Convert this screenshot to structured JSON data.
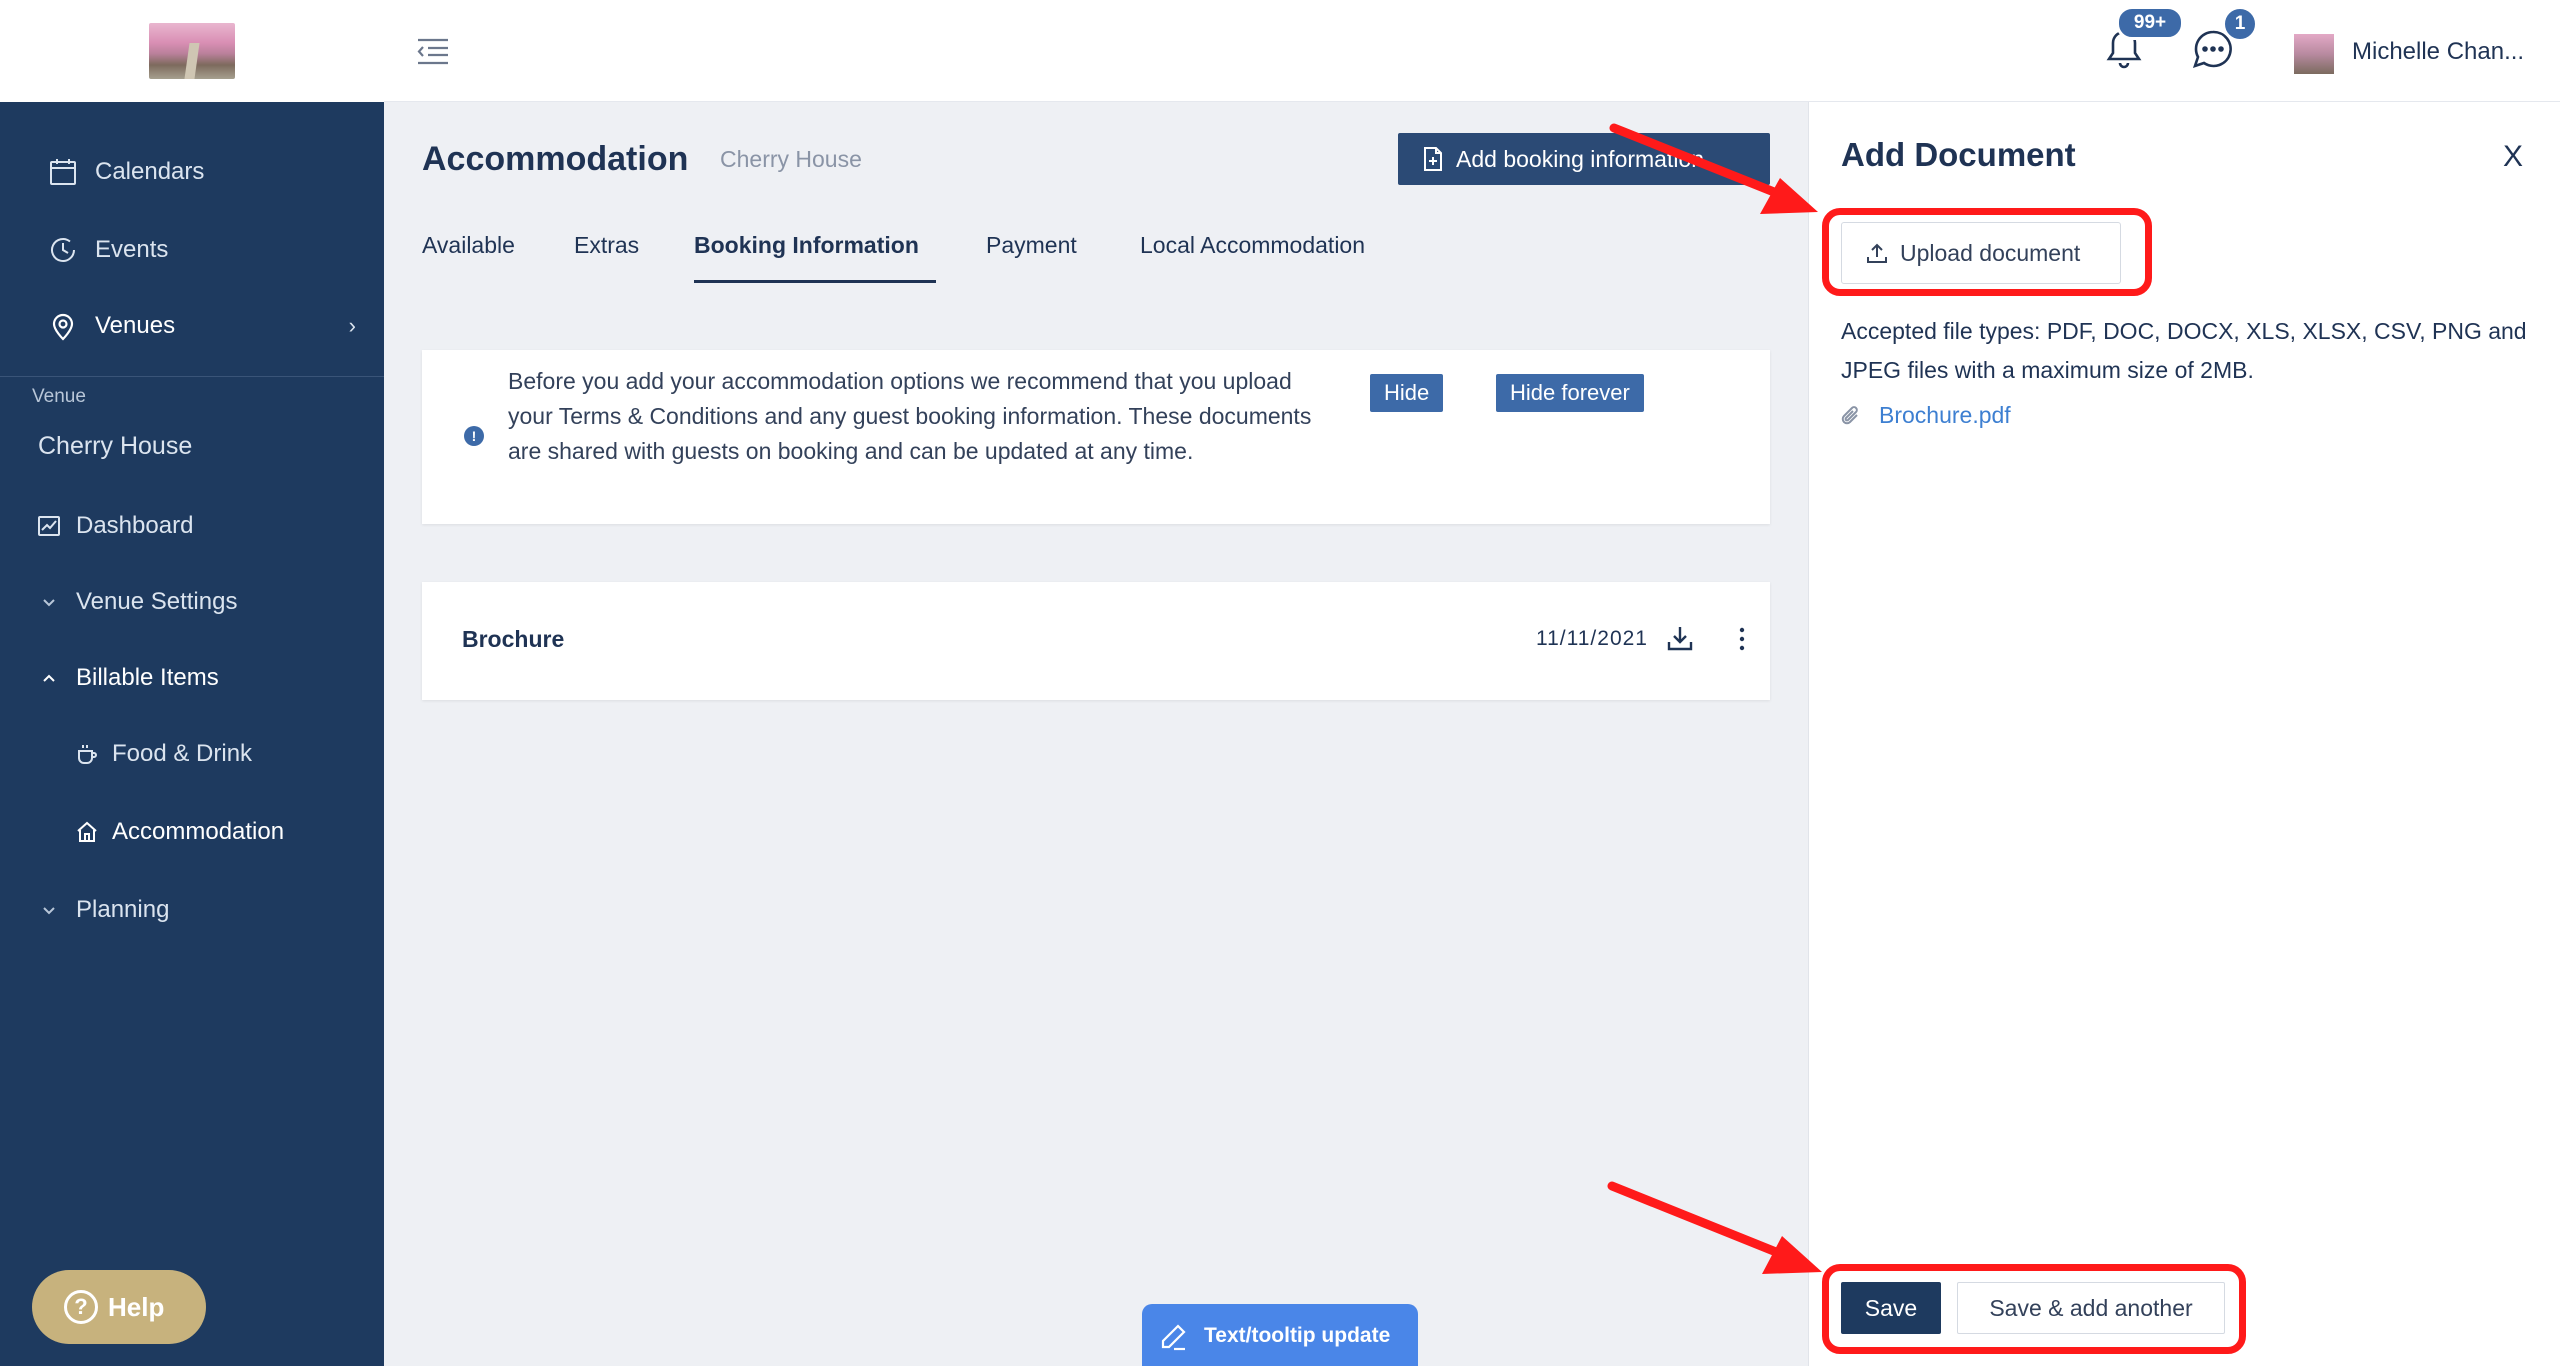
{
  "sidebar": {
    "nav": [
      {
        "label": "Calendars",
        "icon": "calendar-icon"
      },
      {
        "label": "Events",
        "icon": "clock-icon"
      },
      {
        "label": "Venues",
        "icon": "location-pin-icon"
      }
    ],
    "venue_caption": "Venue",
    "venue_name": "Cherry House",
    "items": [
      {
        "label": "Dashboard",
        "icon": "chart-icon"
      },
      {
        "label": "Venue Settings",
        "icon": "chevron-down-icon"
      },
      {
        "label": "Billable Items",
        "icon": "chevron-up-icon"
      },
      {
        "label": "Food & Drink",
        "icon": "coffee-cup-icon"
      },
      {
        "label": "Accommodation",
        "icon": "home-icon"
      },
      {
        "label": "Planning",
        "icon": "chevron-down-icon"
      }
    ],
    "help_label": "Help"
  },
  "header": {
    "notification_count": "99+",
    "message_count": "1",
    "user_name": "Michelle Chan..."
  },
  "main": {
    "title": "Accommodation",
    "subtitle": "Cherry House",
    "add_booking_label": "Add booking information",
    "tabs": [
      {
        "label": "Available"
      },
      {
        "label": "Extras"
      },
      {
        "label": "Booking Information"
      },
      {
        "label": "Payment"
      },
      {
        "label": "Local Accommodation"
      }
    ],
    "info": {
      "text": "Before you add your accommodation options we recommend that you upload your Terms & Conditions and any guest booking information. These documents are shared with guests on booking and can be updated at any time.",
      "hide_label": "Hide",
      "hide_forever_label": "Hide forever"
    },
    "documents": [
      {
        "name": "Brochure",
        "date": "11/11/2021"
      }
    ],
    "tooltip_update_label": "Text/tooltip update"
  },
  "panel": {
    "title": "Add Document",
    "close_label": "X",
    "upload_label": "Upload document",
    "accepted_text": "Accepted file types: PDF, DOC, DOCX, XLS, XLSX, CSV, PNG and JPEG files with a maximum size of 2MB.",
    "attachment_name": "Brochure.pdf",
    "save_label": "Save",
    "save_another_label": "Save & add another"
  },
  "colors": {
    "sidebar": "#1e3a5f",
    "primary": "#2b4a75",
    "accent": "#3d6aa8",
    "link": "#3d7fd1",
    "help": "#c7b27d",
    "annotation": "#ff1a1a"
  }
}
